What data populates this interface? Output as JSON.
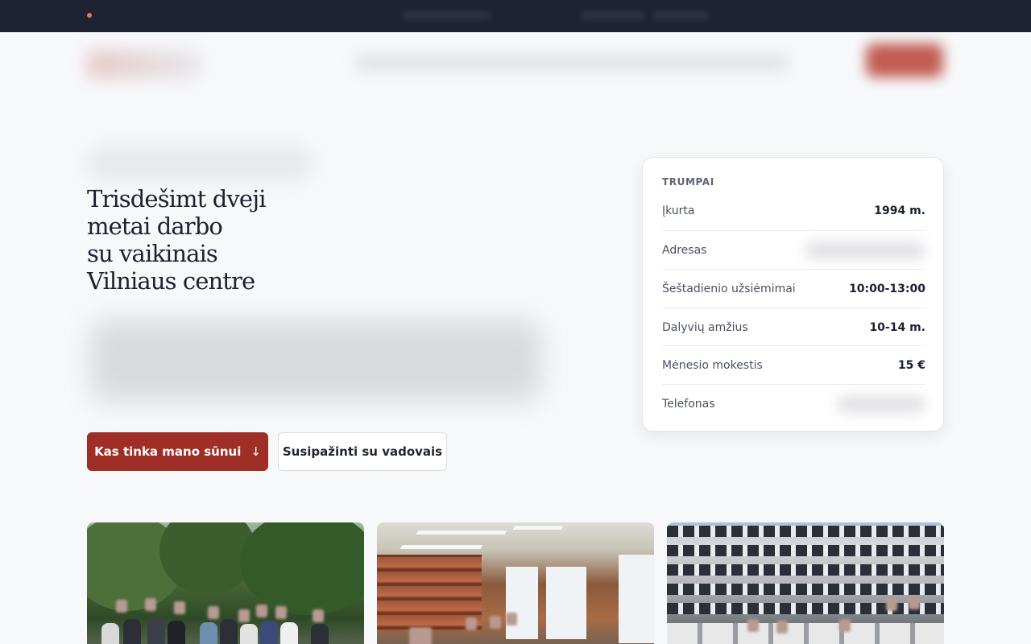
{
  "hero": {
    "title_lines": [
      "Trisdešimt dveji",
      "metai darbo",
      "su vaikinais",
      "Vilniaus centre"
    ]
  },
  "buttons": {
    "primary_label": "Kas tinka mano sūnui",
    "primary_icon": "arrow-down-icon",
    "primary_icon_glyph": "↓",
    "secondary_label": "Susipažinti su vadovais"
  },
  "facts": {
    "heading": "TRUMPAI",
    "rows": [
      {
        "label": "Įkurta",
        "value": "1994 m."
      },
      {
        "label": "Adresas",
        "value": ""
      },
      {
        "label": "Šeštadienio užsiėmimai",
        "value": "10:00-13:00"
      },
      {
        "label": "Dalyvių amžius",
        "value": "10-14 m."
      },
      {
        "label": "Mėnesio mokestis",
        "value": "15 €"
      },
      {
        "label": "Telefonas",
        "value": ""
      }
    ]
  },
  "colors": {
    "accent": "#9f2f26",
    "topbar": "#1e2232",
    "background": "#f7f8fa"
  }
}
